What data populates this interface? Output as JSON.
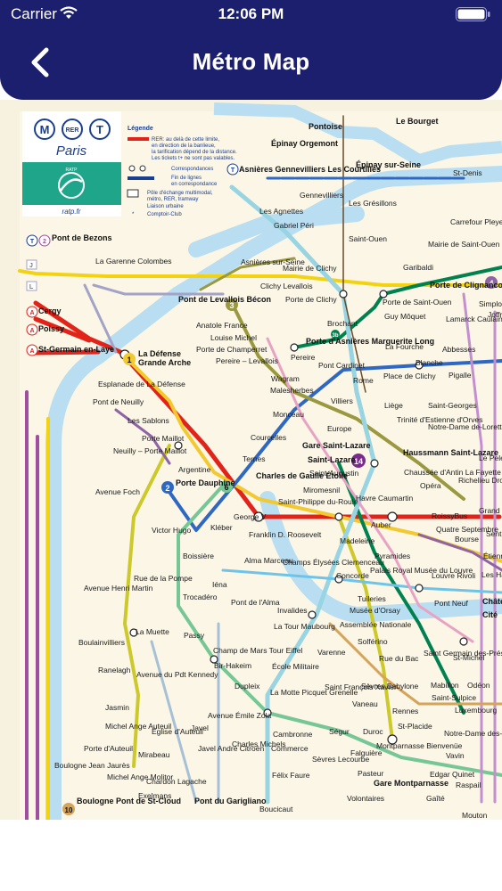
{
  "status": {
    "carrier": "Carrier",
    "time": "12:06 PM"
  },
  "nav": {
    "title": "Métro Map"
  },
  "map": {
    "logo": {
      "badges": [
        "M",
        "RER",
        "T"
      ],
      "city": "Paris",
      "brand": "RATP",
      "url": "ratp.fr"
    },
    "legend": {
      "title": "Légende",
      "items": [
        "RER: au delà de cette limite, en direction de la banlieue, la tarification dépend de la distance. Les tickets t+ ne sont pas valables.",
        "Correspondances",
        "Fin de lignes en correspondance",
        "Pôle d'échange multimodal, métro, RER, tramway",
        "Liaison urbaine",
        "Comptoir-Club"
      ]
    },
    "stations": [
      {
        "id": "pontoise",
        "text": "Pontoise"
      },
      {
        "id": "epinay-orgemont",
        "text": "Épinay Orgemont"
      },
      {
        "id": "le-bourget",
        "text": "Le Bourget"
      },
      {
        "id": "asnieres",
        "text": "Asnières Gennevilliers Les Courtilles"
      },
      {
        "id": "epinay-sur-seine",
        "text": "Épinay sur-Seine"
      },
      {
        "id": "gennevilliers",
        "text": "Gennevilliers"
      },
      {
        "id": "gresillons",
        "text": "Les Grésillons"
      },
      {
        "id": "agnettes",
        "text": "Les Agnettes"
      },
      {
        "id": "gabriel-peri",
        "text": "Gabriel Péri"
      },
      {
        "id": "saint-ouen",
        "text": "Saint-Ouen"
      },
      {
        "id": "garibaldi",
        "text": "Garibaldi"
      },
      {
        "id": "mairie-saint-ouen",
        "text": "Mairie de Saint-Ouen"
      },
      {
        "id": "carrefour-pleyel",
        "text": "Carrefour Pleyel"
      },
      {
        "id": "st-denis",
        "text": "St-Denis"
      },
      {
        "id": "pont-de-bezons",
        "text": "Pont de Bezons"
      },
      {
        "id": "garenne",
        "text": "La Garenne Colombes"
      },
      {
        "id": "asnieres-sur-seine",
        "text": "Asnières sur-Seine"
      },
      {
        "id": "mairie-clichy",
        "text": "Mairie de Clichy"
      },
      {
        "id": "clichy-levallois",
        "text": "Clichy Levallois"
      },
      {
        "id": "porte-clichy",
        "text": "Porte de Clichy"
      },
      {
        "id": "pont-levallois",
        "text": "Pont de Levallois Bécon"
      },
      {
        "id": "cergy",
        "text": "Cergy"
      },
      {
        "id": "poissy",
        "text": "Poissy"
      },
      {
        "id": "st-germain",
        "text": "St-Germain en-Laye"
      },
      {
        "id": "la-defense",
        "text": "La Défense"
      },
      {
        "id": "grande-arche",
        "text": "Grande Arche"
      },
      {
        "id": "esplanade",
        "text": "Esplanade de La Défense"
      },
      {
        "id": "pont-neuilly",
        "text": "Pont de Neuilly"
      },
      {
        "id": "sablons",
        "text": "Les Sablons"
      },
      {
        "id": "porte-maillot",
        "text": "Porte Maillot"
      },
      {
        "id": "neuilly-pm",
        "text": "Neuilly – Porte Maillot"
      },
      {
        "id": "anatole-france",
        "text": "Anatole France"
      },
      {
        "id": "louise-michel",
        "text": "Louise Michel"
      },
      {
        "id": "porte-champerret",
        "text": "Porte de Champerret"
      },
      {
        "id": "pereire-levallois",
        "text": "Pereire – Levallois"
      },
      {
        "id": "pereire",
        "text": "Pereire"
      },
      {
        "id": "brochant",
        "text": "Brochant"
      },
      {
        "id": "porte-asnieres",
        "text": "Porte d'Asnières Marguerite Long"
      },
      {
        "id": "pont-cardinet",
        "text": "Pont Cardinet"
      },
      {
        "id": "wagram",
        "text": "Wagram"
      },
      {
        "id": "malesherbes",
        "text": "Malesherbes"
      },
      {
        "id": "villiers",
        "text": "Villiers"
      },
      {
        "id": "rome",
        "text": "Rome"
      },
      {
        "id": "place-clichy",
        "text": "Place de Clichy"
      },
      {
        "id": "la-fourche",
        "text": "La Fourche"
      },
      {
        "id": "guy-moquet",
        "text": "Guy Môquet"
      },
      {
        "id": "porte-saint-ouen",
        "text": "Porte de Saint-Ouen"
      },
      {
        "id": "porte-clignancourt",
        "text": "Porte de Clignancourt"
      },
      {
        "id": "lamarck",
        "text": "Lamarck Caulaincourt"
      },
      {
        "id": "abbesses",
        "text": "Abbesses"
      },
      {
        "id": "blanche",
        "text": "Blanche"
      },
      {
        "id": "pigalle",
        "text": "Pigalle"
      },
      {
        "id": "liege",
        "text": "Liège"
      },
      {
        "id": "saint-georges",
        "text": "Saint-Georges"
      },
      {
        "id": "trinite",
        "text": "Trinité d'Estienne d'Orves"
      },
      {
        "id": "notre-dame-lorette",
        "text": "Notre-Dame de-Lorette"
      },
      {
        "id": "monceau",
        "text": "Monceau"
      },
      {
        "id": "courcelles",
        "text": "Courcelles"
      },
      {
        "id": "europe",
        "text": "Europe"
      },
      {
        "id": "gare-st-lazare",
        "text": "Gare Saint-Lazare"
      },
      {
        "id": "st-lazare",
        "text": "Saint-Lazare"
      },
      {
        "id": "haussmann",
        "text": "Haussmann Saint-Lazare"
      },
      {
        "id": "saint-augustin",
        "text": "Saint-Augustin"
      },
      {
        "id": "chaussee-antin",
        "text": "Chaussée d'Antin La Fayette"
      },
      {
        "id": "richelieu",
        "text": "Richelieu Drouot"
      },
      {
        "id": "le-pel",
        "text": "Le Pele"
      },
      {
        "id": "argentine",
        "text": "Argentine"
      },
      {
        "id": "ternes",
        "text": "Ternes"
      },
      {
        "id": "cdg-etoile",
        "text": "Charles de Gaulle Étoile"
      },
      {
        "id": "miromesnil",
        "text": "Miromesnil"
      },
      {
        "id": "havre-caumartin",
        "text": "Havre Caumartin"
      },
      {
        "id": "st-philippe",
        "text": "Saint-Philippe du-Roule"
      },
      {
        "id": "opera",
        "text": "Opéra"
      },
      {
        "id": "roissybus",
        "text": "RoissyBus"
      },
      {
        "id": "grands-boulevards",
        "text": "Grand Boulev"
      },
      {
        "id": "avenue-foch",
        "text": "Avenue Foch"
      },
      {
        "id": "porte-dauphine",
        "text": "Porte Dauphine"
      },
      {
        "id": "victor-hugo",
        "text": "Victor Hugo"
      },
      {
        "id": "george-v",
        "text": "George V"
      },
      {
        "id": "kleber",
        "text": "Kléber"
      },
      {
        "id": "franklin",
        "text": "Franklin D. Roosevelt"
      },
      {
        "id": "auber",
        "text": "Auber"
      },
      {
        "id": "madeleine",
        "text": "Madeleine"
      },
      {
        "id": "quatre-septembre",
        "text": "Quatre Septembre"
      },
      {
        "id": "bourse",
        "text": "Bourse"
      },
      {
        "id": "sentier",
        "text": "Sentie"
      },
      {
        "id": "boissiere",
        "text": "Boissière"
      },
      {
        "id": "alma-marceau",
        "text": "Alma Marceau"
      },
      {
        "id": "champs-elysees",
        "text": "Champs Élysées Clemenceau"
      },
      {
        "id": "pyramides",
        "text": "Pyramides"
      },
      {
        "id": "concorde",
        "text": "Concorde"
      },
      {
        "id": "palais-royal",
        "text": "Palais Royal Musée du Louvre"
      },
      {
        "id": "louvre-rivoli",
        "text": "Louvre Rivoli"
      },
      {
        "id": "etienne-marcel",
        "text": "Étienn Marce"
      },
      {
        "id": "les-halles",
        "text": "Les Halles"
      },
      {
        "id": "avenue-henri-martin",
        "text": "Avenue Henri Martin"
      },
      {
        "id": "rue-pompe",
        "text": "Rue de la Pompe"
      },
      {
        "id": "iena",
        "text": "Iéna"
      },
      {
        "id": "trocadero",
        "text": "Trocadéro"
      },
      {
        "id": "tuileries",
        "text": "Tuileries"
      },
      {
        "id": "pont-neuf",
        "text": "Pont Neuf"
      },
      {
        "id": "chatelet",
        "text": "Châtel"
      },
      {
        "id": "pont-alma",
        "text": "Pont de l'Alma"
      },
      {
        "id": "invalides",
        "text": "Invalides"
      },
      {
        "id": "musee-orsay",
        "text": "Musée d'Orsay"
      },
      {
        "id": "cite",
        "text": "Cité"
      },
      {
        "id": "la-muette",
        "text": "La Muette"
      },
      {
        "id": "boulainvilliers",
        "text": "Boulainvilliers"
      },
      {
        "id": "passy",
        "text": "Passy"
      },
      {
        "id": "la-tour-maubourg",
        "text": "La Tour Maubourg"
      },
      {
        "id": "assemblee",
        "text": "Assemblée Nationale"
      },
      {
        "id": "solferino",
        "text": "Solférino"
      },
      {
        "id": "champ-mars",
        "text": "Champ de Mars Tour Eiffel"
      },
      {
        "id": "bir-hakeim",
        "text": "Bir-Hakeim"
      },
      {
        "id": "ranelagh",
        "text": "Ranelagh"
      },
      {
        "id": "avenue-kennedy",
        "text": "Avenue du Pdt Kennedy"
      },
      {
        "id": "ecole-militaire",
        "text": "École Militaire"
      },
      {
        "id": "varenne",
        "text": "Varenne"
      },
      {
        "id": "rue-du-bac",
        "text": "Rue du Bac"
      },
      {
        "id": "st-germain-pres",
        "text": "Saint Germain des-Prés"
      },
      {
        "id": "st-michel",
        "text": "St-Michel"
      },
      {
        "id": "jasmin",
        "text": "Jasmin"
      },
      {
        "id": "dupleix",
        "text": "Dupleix"
      },
      {
        "id": "la-motte-picquet",
        "text": "La Motte Picquet Grenelle"
      },
      {
        "id": "st-francois-xavier",
        "text": "Saint François Xavier"
      },
      {
        "id": "sevres-babylone",
        "text": "Sèvres Babylone"
      },
      {
        "id": "mabillon",
        "text": "Mabillon"
      },
      {
        "id": "odeon",
        "text": "Odéon"
      },
      {
        "id": "saint-sulpice",
        "text": "Saint-Sulpice"
      },
      {
        "id": "luxembourg",
        "text": "Luxembourg"
      },
      {
        "id": "michel-ange-auteuil",
        "text": "Michel Ange Auteuil"
      },
      {
        "id": "eglise-auteuil",
        "text": "Église d'Auteuil"
      },
      {
        "id": "avenue-emile-zola",
        "text": "Avenue Émile Zola"
      },
      {
        "id": "javel",
        "text": "Javel"
      },
      {
        "id": "cambronne",
        "text": "Cambronne"
      },
      {
        "id": "segur",
        "text": "Ségur"
      },
      {
        "id": "vaneau",
        "text": "Vaneau"
      },
      {
        "id": "duroc",
        "text": "Duroc"
      },
      {
        "id": "rennes",
        "text": "Rennes"
      },
      {
        "id": "saint-placide",
        "text": "St-Placide"
      },
      {
        "id": "notre-dame-champs",
        "text": "Notre-Dame des-Champs"
      },
      {
        "id": "porte-auteuil",
        "text": "Porte d'Auteuil"
      },
      {
        "id": "mirabeau",
        "text": "Mirabeau"
      },
      {
        "id": "javel-andre-citroen",
        "text": "Javel André Citroën"
      },
      {
        "id": "charles-michels",
        "text": "Charles Michels"
      },
      {
        "id": "commerce",
        "text": "Commerce"
      },
      {
        "id": "sevres-lecourbe",
        "text": "Sèvres Lecourbe"
      },
      {
        "id": "falguiere",
        "text": "Falguière"
      },
      {
        "id": "montparnasse",
        "text": "Montparnasse Bienvenüe"
      },
      {
        "id": "vavin",
        "text": "Vavin"
      },
      {
        "id": "boulogne-jean-jaures",
        "text": "Boulogne Jean Jaurès"
      },
      {
        "id": "michel-ange-molitor",
        "text": "Michel Ange Molitor"
      },
      {
        "id": "chardon-lagache",
        "text": "Chardon Lagache"
      },
      {
        "id": "exelmans",
        "text": "Exelmans"
      },
      {
        "id": "felix-faure",
        "text": "Félix Faure"
      },
      {
        "id": "pasteur",
        "text": "Pasteur"
      },
      {
        "id": "gare-montparnasse",
        "text": "Gare Montparnasse"
      },
      {
        "id": "edgar-quinet",
        "text": "Edgar Quinet"
      },
      {
        "id": "raspail",
        "text": "Raspail"
      },
      {
        "id": "boulogne-pont-st-cloud",
        "text": "Boulogne Pont de St-Cloud"
      },
      {
        "id": "pont-garigliano",
        "text": "Pont du Garigliano"
      },
      {
        "id": "boucicaut",
        "text": "Boucicaut"
      },
      {
        "id": "volontaires",
        "text": "Volontaires"
      },
      {
        "id": "gaite",
        "text": "Gaîté"
      },
      {
        "id": "mouton",
        "text": "Mouton"
      },
      {
        "id": "simplon",
        "text": "Simplo"
      },
      {
        "id": "jules-joffrin",
        "text": "Joffr"
      }
    ]
  },
  "colors": {
    "nav_bg": "#1b1f6e",
    "map_bg": "#f7f1df",
    "seine": "#b9def2",
    "rer_a": "#e2231a",
    "rer_c": "#f3d311",
    "line_1": "#f2c931",
    "line_2": "#2e68c3",
    "line_3": "#9a9940",
    "line_6": "#76c696",
    "line_9": "#cec92b",
    "line_12": "#00814f",
    "line_13": "#98d4e2"
  }
}
